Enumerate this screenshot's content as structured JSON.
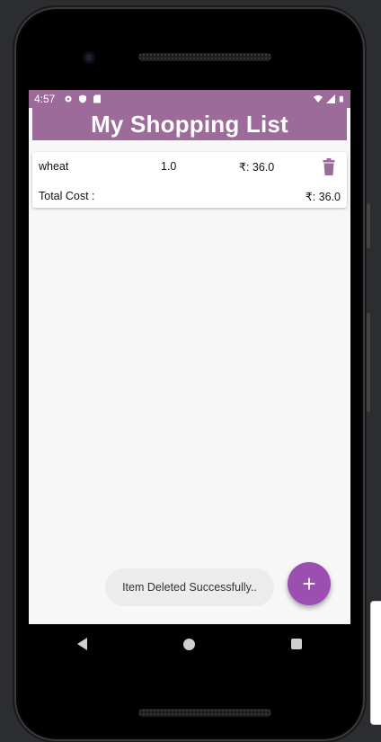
{
  "status_bar": {
    "time": "4:57",
    "left_icons": [
      "gear-icon",
      "shield-icon",
      "sd-card-icon"
    ],
    "right_icons": [
      "wifi-icon",
      "signal-icon",
      "battery-icon"
    ]
  },
  "app_bar": {
    "title": "My Shopping List"
  },
  "items": [
    {
      "name": "wheat",
      "quantity": "1.0",
      "price": "₹: 36.0"
    }
  ],
  "summary": {
    "total_label": "Total Cost :",
    "total_value": "₹: 36.0"
  },
  "toast": {
    "message": "Item Deleted Successfully.."
  },
  "fab": {
    "label": "+"
  },
  "colors": {
    "primary": "#9c6b99",
    "fab": "#9b4fb0",
    "delete_icon": "#9c6b99",
    "background": "#f7f7f7"
  }
}
